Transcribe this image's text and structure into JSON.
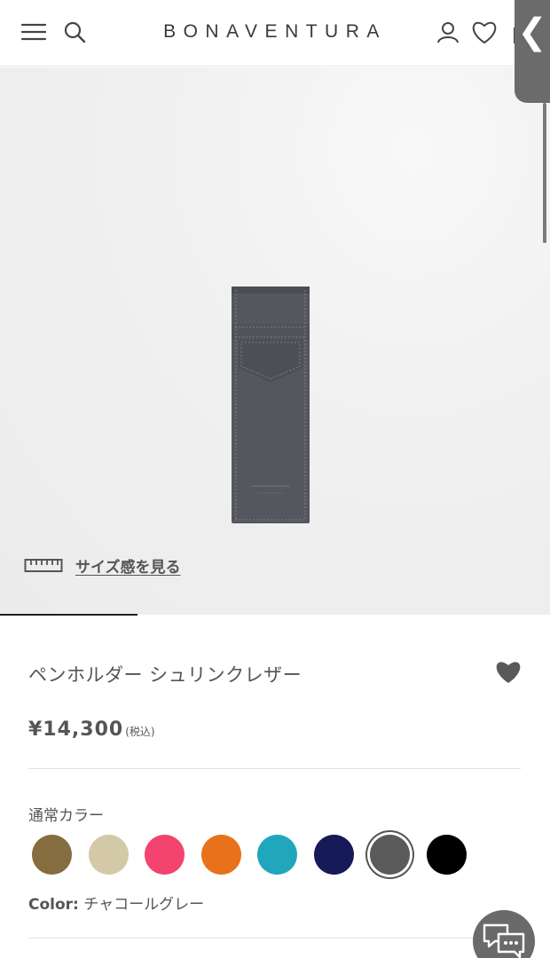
{
  "header": {
    "logo": "BONAVENTURA",
    "icons": [
      "menu-icon",
      "search-icon",
      "account-icon",
      "heart-icon",
      "cart-icon"
    ]
  },
  "side_tab": {
    "icon": "chevron-left-icon",
    "glyph": "❮"
  },
  "hero": {
    "product_image": "charcoal-grey-leather-pen-holder",
    "size_link_icon": "ruler-icon",
    "size_link_label": "サイズ感を見る"
  },
  "product": {
    "title": "ペンホルダー シュリンクレザー",
    "price": "¥14,300",
    "tax_note": "(税込)"
  },
  "colors": {
    "heading": "通常カラー",
    "swatches": [
      "#856d40",
      "#d3c9a7",
      "#f2446e",
      "#e8711b",
      "#20a6bd",
      "#171a58",
      "#5a5a5a",
      "#000000"
    ],
    "selected_index": 6,
    "label_key": "Color:",
    "label_value": "チャコールグレー"
  },
  "chat": {
    "icon": "chat-bubbles-icon"
  }
}
